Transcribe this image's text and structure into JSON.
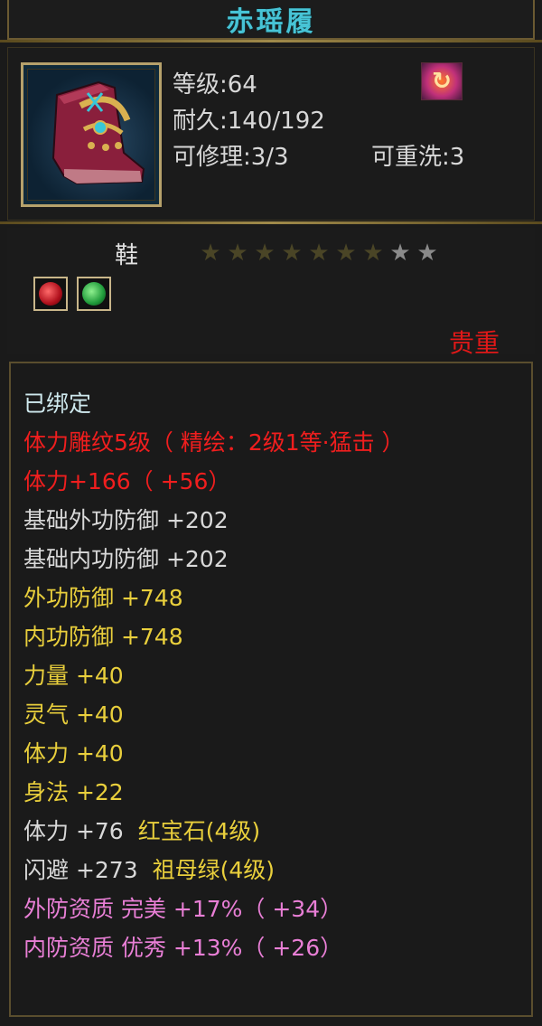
{
  "item": {
    "name": "赤瑶履",
    "level": "等级:64",
    "durability": "耐久:140/192",
    "repair": "可修理:3/3",
    "rewash": "可重洗:3",
    "element_icon": "fire-element-icon",
    "type": "鞋",
    "stars": {
      "total": 9,
      "lit": 7
    },
    "gems": [
      {
        "name": "ruby-gem-icon",
        "color": "#d81c2a"
      },
      {
        "name": "emerald-gem-icon",
        "color": "#2faa3c"
      }
    ],
    "rarity": "贵重"
  },
  "attributes": {
    "bound": "已绑定",
    "engrave": "体力雕纹5级（ 精绘：2级1等·猛击 ）",
    "stamina_main": "体力+166（ +56）",
    "base_ext_def": "基础外功防御  +202",
    "base_int_def": "基础内功防御  +202",
    "ext_def": "外功防御  +748",
    "int_def": "内功防御  +748",
    "strength": "力量  +40",
    "spirit": "灵气  +40",
    "stamina": "体力  +40",
    "agility": "身法  +22",
    "gem1_stat": "体力  +76",
    "gem1_name": "红宝石(4级)",
    "gem2_stat": "闪避  +273",
    "gem2_name": "祖母绿(4级)",
    "ext_quality": "外防资质   完美  +17%（ +34）",
    "int_quality": "内防资质   优秀  +13%（ +26）"
  },
  "colors": {
    "title": "#47c4d6",
    "red": "#f01e1e",
    "yellow": "#e9cf3c",
    "pink": "#e97fd6",
    "gold_border": "#b6a16b"
  }
}
